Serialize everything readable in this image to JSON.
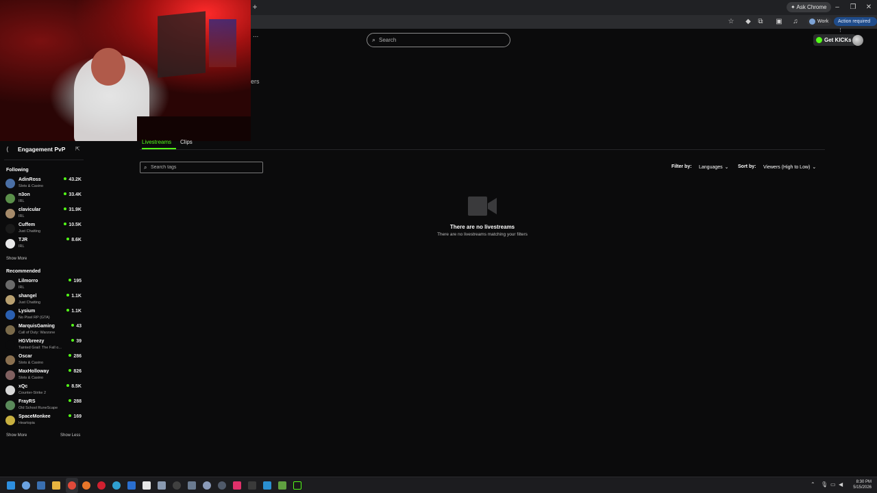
{
  "browser": {
    "new_tab_glyph": "+",
    "ask_chrome": "Ask Chrome",
    "address_fragment": "...",
    "profile_label": "Work",
    "action_required": "Action required"
  },
  "header": {
    "search_placeholder": "Search",
    "get_kicks": "Get KICKs",
    "viewers_fragment": "ers"
  },
  "sidebar": {
    "category_title": "Engagement PvP",
    "following_label": "Following",
    "following": [
      {
        "name": "AdinRoss",
        "category": "Slots & Casino",
        "viewers": "43.2K",
        "avatar_color": "#4a6fa5"
      },
      {
        "name": "n3on",
        "category": "IRL",
        "viewers": "33.4K",
        "avatar_color": "#5a8f4a"
      },
      {
        "name": "clavicular",
        "category": "IRL",
        "viewers": "31.9K",
        "avatar_color": "#a58a6a"
      },
      {
        "name": "Cuffem",
        "category": "Just Chatting",
        "viewers": "10.5K",
        "avatar_color": "#1a1a1a"
      },
      {
        "name": "TJR",
        "category": "IRL",
        "viewers": "8.6K",
        "avatar_color": "#e8e8e8"
      }
    ],
    "show_more_following": "Show More",
    "recommended_label": "Recommended",
    "recommended": [
      {
        "name": "Lilmorro",
        "category": "IRL",
        "viewers": "195",
        "avatar_color": "#6a6a6a"
      },
      {
        "name": "shangel",
        "category": "Just Chatting",
        "viewers": "1.1K",
        "avatar_color": "#b8a070"
      },
      {
        "name": "Lysium",
        "category": "No Pixel RP (GTA)",
        "viewers": "1.1K",
        "avatar_color": "#2a5fb0"
      },
      {
        "name": "MarquisGaming",
        "category": "Call of Duty: Warzone",
        "viewers": "43",
        "avatar_color": "#7a6a4a"
      },
      {
        "name": "HGVbreezy",
        "category": "Tainted Grail: The Fall o...",
        "viewers": "39",
        "avatar_color": "#0b0b0c"
      },
      {
        "name": "Oscar",
        "category": "Slots & Casino",
        "viewers": "286",
        "avatar_color": "#8a7050"
      },
      {
        "name": "MaxHolloway",
        "category": "Slots & Casino",
        "viewers": "826",
        "avatar_color": "#806060"
      },
      {
        "name": "xQc",
        "category": "Counter-Strike 2",
        "viewers": "8.5K",
        "avatar_color": "#d8d8d8"
      },
      {
        "name": "FrayRS",
        "category": "Old School RuneScape",
        "viewers": "288",
        "avatar_color": "#5a8a5a"
      },
      {
        "name": "SpaceMonkee",
        "category": "Heartopia",
        "viewers": "169",
        "avatar_color": "#c8b040"
      }
    ],
    "show_more_recommended": "Show More",
    "show_less": "Show Less"
  },
  "main": {
    "tabs": [
      {
        "label": "Livestreams"
      },
      {
        "label": "Clips"
      }
    ],
    "tag_search_placeholder": "Search tags",
    "filter_label": "Filter by:",
    "filter_value": "Languages",
    "sort_label": "Sort by:",
    "sort_value": "Viewers (High to Low)",
    "empty_title": "There are no livestreams",
    "empty_subtitle": "There are no livestreams matching your filters"
  },
  "taskbar": {
    "time": "8:30 PM",
    "date": "5/15/2026"
  },
  "colors": {
    "accent": "#53fc18",
    "background": "#0b0b0c"
  }
}
